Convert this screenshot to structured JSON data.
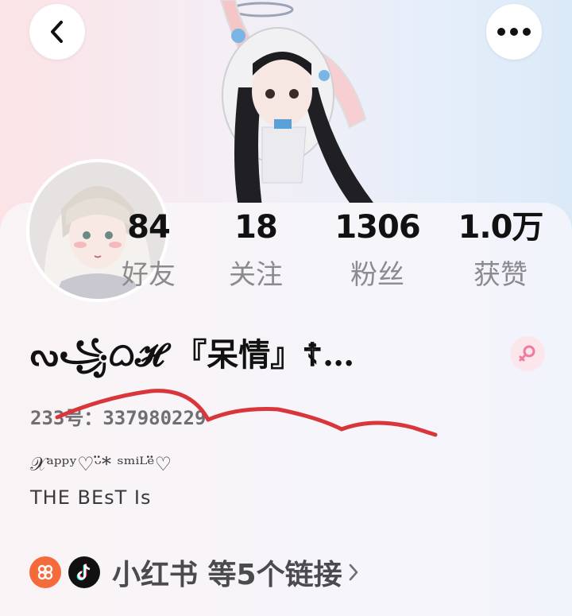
{
  "header": {
    "back_icon": "chevron-left-icon",
    "more_icon": "more-horizontal-icon"
  },
  "stats": [
    {
      "value": "84",
      "label": "好友"
    },
    {
      "value": "18",
      "label": "关注"
    },
    {
      "value": "1306",
      "label": "粉丝"
    },
    {
      "value": "1.0万",
      "label": "获赞"
    }
  ],
  "profile": {
    "nickname": "ᔓ꧁ᜊ𝓗 『呆情』☦︎…",
    "gender_icon": "female-icon",
    "uid": "233号：337980229",
    "bio_line1": "𝒳ᵃᵖᵖʸ♡ᵕ̈* ˢᵐⁱᴸᵉ̈♡",
    "bio_line2": "THE BEsT Is"
  },
  "links": {
    "icons": [
      "xiaohongshu-icon",
      "tiktok-icon"
    ],
    "label": "小红书 等5个链接"
  },
  "colors": {
    "scribble": "#d9363b",
    "gender_pink": "#f07aa0",
    "xhs_orange": "#f46a3a"
  }
}
